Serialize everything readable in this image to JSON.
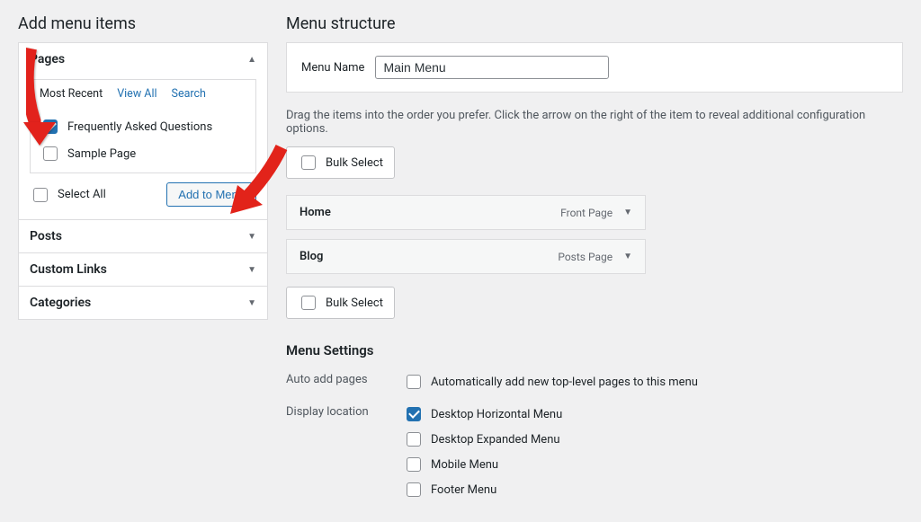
{
  "left": {
    "heading": "Add menu items",
    "panels": {
      "pages": {
        "title": "Pages",
        "tabs": {
          "recent": "Most Recent",
          "all": "View All",
          "search": "Search"
        },
        "items": [
          {
            "label": "Frequently Asked Questions",
            "checked": true
          },
          {
            "label": "Sample Page",
            "checked": false
          }
        ],
        "select_all": "Select All",
        "add_btn": "Add to Menu"
      },
      "posts": "Posts",
      "custom_links": "Custom Links",
      "categories": "Categories"
    }
  },
  "right": {
    "heading": "Menu structure",
    "menu_name_label": "Menu Name",
    "menu_name_value": "Main Menu",
    "instructions": "Drag the items into the order you prefer. Click the arrow on the right of the item to reveal additional configuration options.",
    "bulk_select": "Bulk Select",
    "menu_items": [
      {
        "title": "Home",
        "type": "Front Page"
      },
      {
        "title": "Blog",
        "type": "Posts Page"
      }
    ],
    "settings": {
      "heading": "Menu Settings",
      "auto_add_label": "Auto add pages",
      "auto_add_text": "Automatically add new top-level pages to this menu",
      "display_label": "Display location",
      "locations": [
        {
          "label": "Desktop Horizontal Menu",
          "checked": true
        },
        {
          "label": "Desktop Expanded Menu",
          "checked": false
        },
        {
          "label": "Mobile Menu",
          "checked": false
        },
        {
          "label": "Footer Menu",
          "checked": false
        }
      ]
    }
  }
}
